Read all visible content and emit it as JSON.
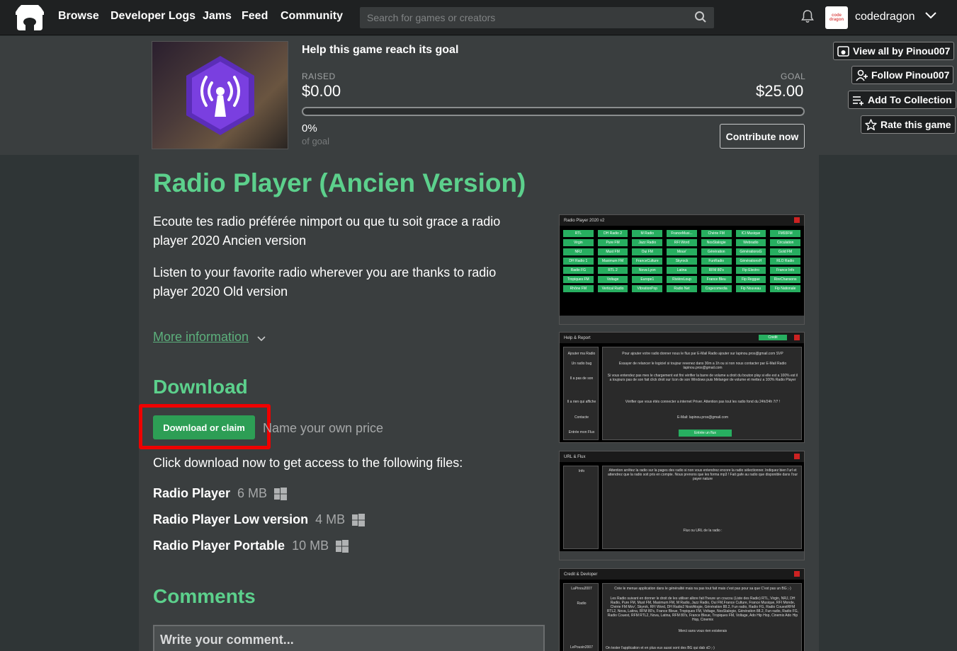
{
  "nav": {
    "links": [
      "Browse",
      "Developer Logs",
      "Jams",
      "Feed",
      "Community"
    ],
    "search_placeholder": "Search for games or creators",
    "username": "codedragon",
    "avatar_text": "code dragon"
  },
  "funding": {
    "title": "Help this game reach its goal",
    "raised_label": "RAISED",
    "raised_value": "$0.00",
    "goal_label": "GOAL",
    "goal_value": "$25.00",
    "progress_fraction": 0,
    "percent": "0%",
    "percent_label": "of goal",
    "contribute_label": "Contribute now"
  },
  "side_buttons": {
    "view_all": "View all by Pinou007",
    "follow": "Follow Pinou007",
    "collection": "Add To Collection",
    "rate": "Rate this game"
  },
  "game": {
    "title": "Radio Player (Ancien Version)",
    "desc_fr": "Ecoute tes radio préférée nimport ou que tu soit grace a radio player 2020 Ancien version",
    "desc_en": "Listen to your favorite radio wherever you are thanks to radio player 2020 Old version",
    "more_info": "More information"
  },
  "download": {
    "heading": "Download",
    "button": "Download or claim",
    "own_price": "Name your own price",
    "click_text": "Click download now to get access to the following files:",
    "files": [
      {
        "name": "Radio Player",
        "size": "6 MB",
        "platform": "windows-icon"
      },
      {
        "name": "Radio Player Low version",
        "size": "4 MB",
        "platform": "windows-icon"
      },
      {
        "name": "Radio Player Portable",
        "size": "10 MB",
        "platform": "windows-icon"
      }
    ]
  },
  "comments": {
    "heading": "Comments",
    "placeholder": "Write your comment..."
  },
  "screenshots": {
    "s1_title": "Radio Player 2020 v2",
    "s1_stations": [
      "RTL",
      "DH Radio 2",
      "M Radio",
      "FranceMusi...",
      "Chérie FM",
      "ICI Musique",
      "FM93FM",
      "Virgin",
      "Pure FM",
      "Jazz Radio",
      "RFI Word",
      "NosStalogie",
      "Webradio",
      "Circulation",
      "NRJ",
      "Must FM",
      "Oui FM",
      "Mouv'",
      "Génération",
      "GénérationsG",
      "Gold FM",
      "DH Radio 1",
      "Maximum FM",
      "FranceCulture",
      "Skyrock",
      "FunRadio",
      "GénérationsH",
      "RLO Radio",
      "Radio FG",
      "RTL 2",
      "Nova Lyon",
      "Latina",
      "RFM 80's",
      "Fip Electro",
      "France Info",
      "Tropiques FM",
      "Voltage",
      "Europe1",
      "RivièreLoup",
      "France Bleu",
      "Fip Reggae",
      "RireChansons",
      "Rhône FM",
      "Vertical Radio",
      "VibrationPop",
      "Radio Net",
      "Cogecomedia",
      "Fip Nouveau",
      "Fip Nationale"
    ],
    "s2_title": "Help & Report",
    "s2_credit": "Credit",
    "s2_left": [
      "Ajouter ma Radio",
      "Un radio bug",
      "Il a pas de son",
      "Il a rien qui affiche",
      "Contacte",
      "Entrée mon Flux"
    ],
    "s2_lines": [
      "Pour ajouter votre radio donner nous le flux par E-Mail Radio ajouter sur lapinou.pros@gmail.com SVP",
      "Essayer de relancer le logiciel si toujour revenez dans 30m a 1h ou si non nous contacter par E-Mail Radio lapinou.pros@gmail.com",
      "Si vous entendez pas mes le chargement est fini vérifier la barre de volume a droit du bouton play si elle est a 100% est il a toujours pas de son fait click droit sur Icon de son Windows puis Mélanger de volume et mettez a 100% Radio Player",
      "Vérifier que vous étés connecter a internet Priver. Attention pas tout les radio fond du 24h/24h 7/7 !",
      "E-Mail: lapinou.pros@gmail.com"
    ],
    "s2_button": "Entrée un flux",
    "s3_title": "URL & Flux",
    "s3_left": "Info",
    "s3_line": "Attention arrêtez la radio sur la pages des radio si non vous entendrez encore la radio sélectionner. Indiquez bien l'url et attendrez que la radio soit pris en compte. Nous prenons que les forma mp3 ! Fait gafe au radio que disponible dans l'our payer nature",
    "s3_label": "Flux ou URL de la radio :",
    "s4_title": "Credit & Devloper",
    "s4_left": [
      "LaPinou2007",
      "Radio",
      "LePousin2007"
    ],
    "s4_lines": [
      "Crée le menue application dans le généralité mais na pas tout fait mais c'est pas pour sa que C'est pas un BG ;-)",
      "Les Radio suivant en donner le droit de les utiliser allore fait l'heure un coucou (Liste des Radio) RTL, Virgin, NRJ, DH Radio, Pure FM, Must FM, Maximum FM, M Radio, Jazz Radio, Oui FM,France Culture, France Musique, RFI Monde, Chérie FM Mov', Skyrok, RFI Word, DH Radio2 NostAlogie, Génération 88.2, Fun radio, Radio FG, Radio CouestRFM RTL2, Nova, Latina, RFM 80's, France Bleue, Tropiques FM, Voltage, NosStalogie, Génération 88.2, Fun radio, Radio FG, Radio Couest, RFM RTL2, Nova, Latina, RFM 80's, France Bleue, Tropiques FM, Voltage, Ado Hip Hop, Cinemix Ado Hip Hop, Cinemix",
      "Merci sans vous rien existerais",
      "On tester l'application et en plus eux aussi sont des BG qui dab xD ;-)"
    ]
  },
  "colors": {
    "accent_green": "#5cd08c",
    "button_green": "#2d9e55",
    "highlight_red": "#ef0000"
  }
}
